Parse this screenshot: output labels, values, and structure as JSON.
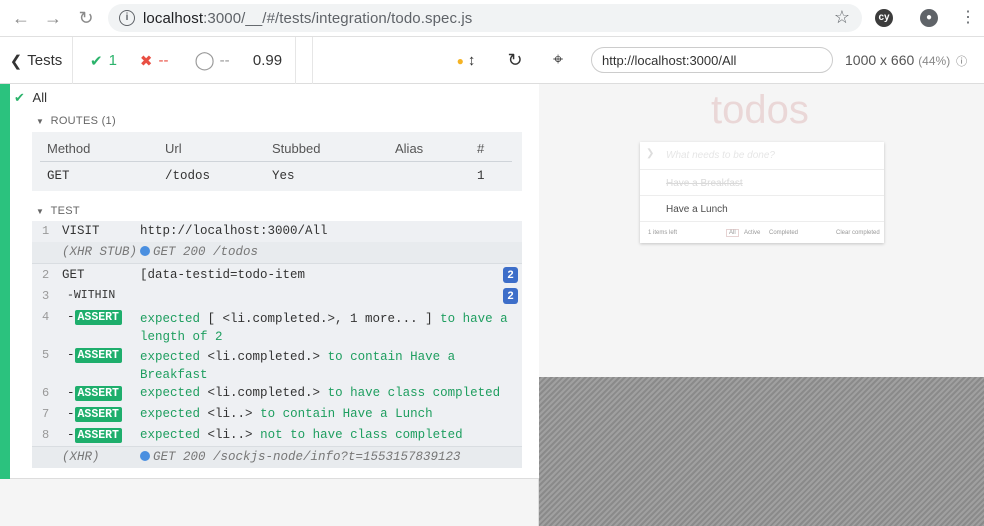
{
  "browser": {
    "url_host": "localhost",
    "url_rest": ":3000/__/#/tests/integration/todo.spec.js"
  },
  "reporter": {
    "tests_label": "Tests",
    "passed": "1",
    "failed": "--",
    "pending": "--",
    "duration": "0.99",
    "all_label": "All",
    "routes_title": "ROUTES (1)",
    "routes_headers": [
      "Method",
      "Url",
      "Stubbed",
      "Alias",
      "#"
    ],
    "routes_row": [
      "GET",
      "/todos",
      "Yes",
      "",
      "1"
    ],
    "test_title": "TEST",
    "commands": [
      {
        "num": "1",
        "name": "VISIT",
        "msg": "http://localhost:3000/All"
      },
      {
        "num": "",
        "name": "(XHR STUB)",
        "msg": "GET 200 /todos"
      },
      {
        "num": "2",
        "name": "GET",
        "msg": "[data-testid=todo-item",
        "badge": "2"
      },
      {
        "num": "3",
        "name": "-WITHIN",
        "msg": "",
        "badge": "2"
      },
      {
        "num": "4",
        "name": "ASSERT",
        "msg_a": "expected",
        "msg_b": "[ <li.completed.>, 1 more... ]",
        "msg_c": "to have a length of",
        "msg_d": "2"
      },
      {
        "num": "5",
        "name": "ASSERT",
        "msg_a": "expected",
        "msg_b": "<li.completed.>",
        "msg_c": "to contain",
        "msg_d": "Have a Breakfast"
      },
      {
        "num": "6",
        "name": "ASSERT",
        "msg_a": "expected",
        "msg_b": "<li.completed.>",
        "msg_c": "to have class",
        "msg_d": "completed"
      },
      {
        "num": "7",
        "name": "ASSERT",
        "msg_a": "expected",
        "msg_b": "<li..>",
        "msg_c": "to contain",
        "msg_d": "Have a Lunch"
      },
      {
        "num": "8",
        "name": "ASSERT",
        "msg_a": "expected",
        "msg_b": "<li..>",
        "msg_c": "not to have class",
        "msg_d": "completed"
      },
      {
        "num": "",
        "name": "(XHR)",
        "msg": "GET 200 /sockjs-node/info?t=1553157839123"
      }
    ]
  },
  "aut": {
    "url": "http://localhost:3000/All",
    "size": "1000 x 660",
    "zoom": "(44%)",
    "title": "todos",
    "placeholder": "What needs to be done?",
    "items": [
      "Have a Breakfast",
      "Have a Lunch"
    ],
    "footer": {
      "left": "1 items left",
      "all": "All",
      "active": "Active",
      "completed": "Completed",
      "clear": "Clear completed"
    }
  },
  "colors": {
    "pass": "#2bb36b",
    "fail": "#e94f43",
    "assert": "#1eae6c",
    "badge": "#3d6ec9"
  }
}
